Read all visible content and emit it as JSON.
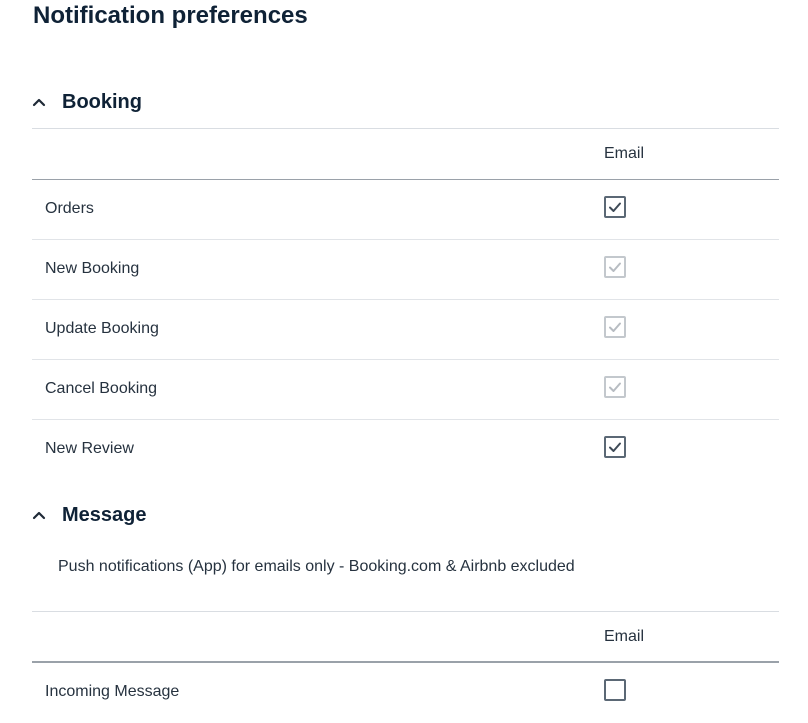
{
  "page_title": "Notification preferences",
  "sections": [
    {
      "title": "Booking",
      "expanded": true,
      "column_header": "Email",
      "rows": [
        {
          "label": "Orders",
          "email_checked": true,
          "disabled": false
        },
        {
          "label": "New Booking",
          "email_checked": true,
          "disabled": true
        },
        {
          "label": "Update Booking",
          "email_checked": true,
          "disabled": true
        },
        {
          "label": "Cancel Booking",
          "email_checked": true,
          "disabled": true
        },
        {
          "label": "New Review",
          "email_checked": true,
          "disabled": false
        }
      ]
    },
    {
      "title": "Message",
      "expanded": true,
      "note": "Push notifications (App) for emails only - Booking.com & Airbnb excluded",
      "column_header": "Email",
      "rows": [
        {
          "label": "Incoming Message",
          "email_checked": false,
          "disabled": false
        }
      ]
    }
  ],
  "colors": {
    "title": "#0f2236",
    "text": "#26323f",
    "checkbox_border": "#5b6875",
    "checkbox_disabled": "#c3c8cd"
  },
  "icons": {
    "section_toggle": "chevron-up-icon",
    "checked": "checkmark-icon"
  }
}
